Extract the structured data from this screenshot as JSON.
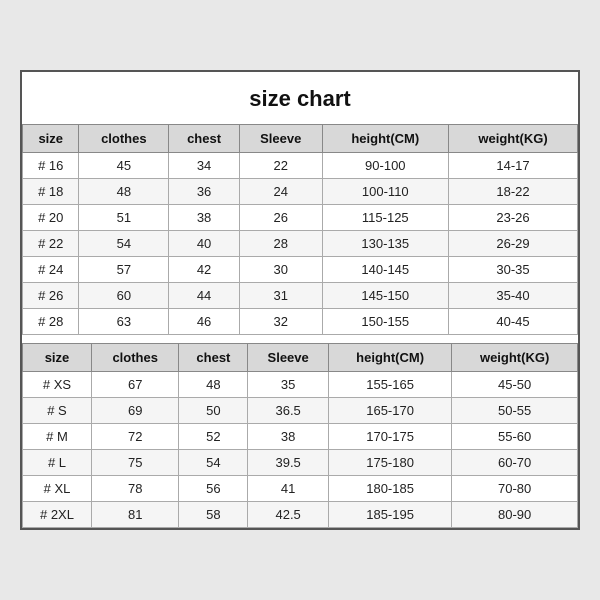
{
  "title": "size chart",
  "headers": [
    "size",
    "clothes",
    "chest",
    "Sleeve",
    "height(CM)",
    "weight(KG)"
  ],
  "table1": [
    [
      "# 16",
      "45",
      "34",
      "22",
      "90-100",
      "14-17"
    ],
    [
      "# 18",
      "48",
      "36",
      "24",
      "100-110",
      "18-22"
    ],
    [
      "# 20",
      "51",
      "38",
      "26",
      "115-125",
      "23-26"
    ],
    [
      "# 22",
      "54",
      "40",
      "28",
      "130-135",
      "26-29"
    ],
    [
      "# 24",
      "57",
      "42",
      "30",
      "140-145",
      "30-35"
    ],
    [
      "# 26",
      "60",
      "44",
      "31",
      "145-150",
      "35-40"
    ],
    [
      "# 28",
      "63",
      "46",
      "32",
      "150-155",
      "40-45"
    ]
  ],
  "table2": [
    [
      "# XS",
      "67",
      "48",
      "35",
      "155-165",
      "45-50"
    ],
    [
      "# S",
      "69",
      "50",
      "36.5",
      "165-170",
      "50-55"
    ],
    [
      "# M",
      "72",
      "52",
      "38",
      "170-175",
      "55-60"
    ],
    [
      "# L",
      "75",
      "54",
      "39.5",
      "175-180",
      "60-70"
    ],
    [
      "# XL",
      "78",
      "56",
      "41",
      "180-185",
      "70-80"
    ],
    [
      "# 2XL",
      "81",
      "58",
      "42.5",
      "185-195",
      "80-90"
    ]
  ]
}
